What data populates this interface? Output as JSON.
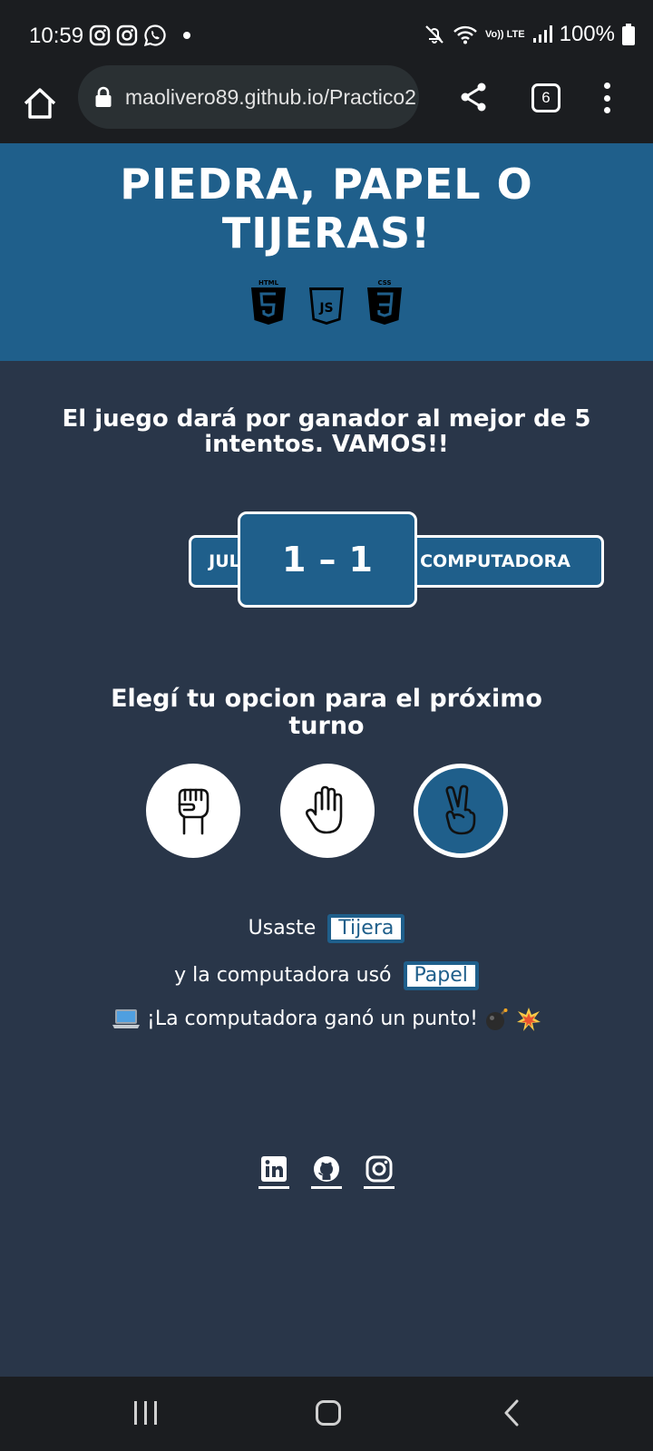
{
  "status_bar": {
    "time": "10:59",
    "battery": "100%",
    "network_label": "Vo)) LTE"
  },
  "browser": {
    "url": "maolivero89.github.io/Practico2",
    "tab_count": "6"
  },
  "header": {
    "title_line1": "PIEDRA, PAPEL O",
    "title_line2": "TIJERAS!",
    "tech_icons": [
      "html5-icon",
      "js-icon",
      "css3-icon"
    ]
  },
  "intro": "El juego dará por ganador al mejor de 5 intentos. VAMOS!!",
  "scoreboard": {
    "player_name": "JULI",
    "player_score": "1",
    "separator": "–",
    "computer_score": "1",
    "computer_name": "COMPUTADORA"
  },
  "prompt": "Elegí tu opcion para el próximo turno",
  "choices": [
    {
      "name": "piedra",
      "icon": "fist-icon",
      "selected": false
    },
    {
      "name": "papel",
      "icon": "open-hand-icon",
      "selected": false
    },
    {
      "name": "tijera",
      "icon": "peace-hand-icon",
      "selected": true
    }
  ],
  "result": {
    "used_prefix": "Usaste",
    "used_value": "Tijera",
    "computer_prefix": "y la computadora usó",
    "computer_value": "Papel",
    "outcome": "¡La computadora ganó un punto!"
  },
  "socials": [
    "linkedin-icon",
    "github-icon",
    "instagram-icon"
  ],
  "colors": {
    "background": "#293649",
    "accent": "#1f5f8b",
    "system_bar": "#1b1d20"
  }
}
